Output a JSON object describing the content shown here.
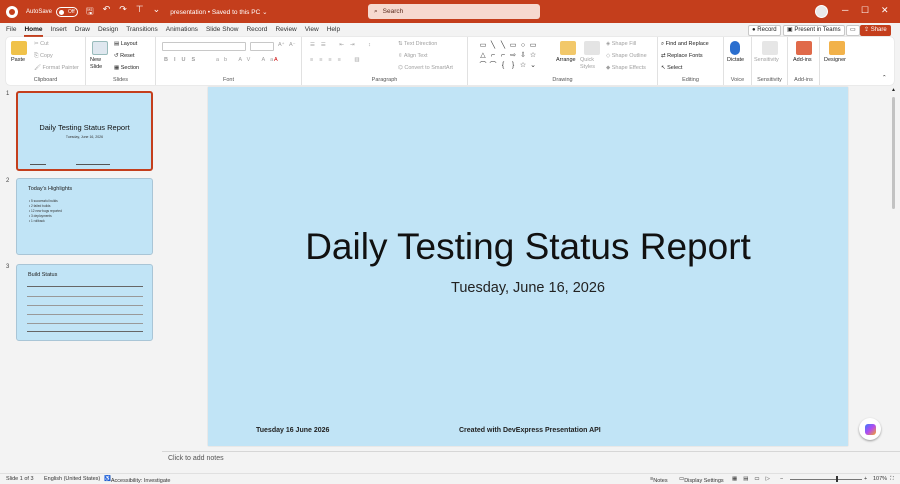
{
  "titlebar": {
    "autosave_label": "AutoSave",
    "autosave_state": "Off",
    "doc_title": "presentation • Saved to this PC ⌄",
    "search_placeholder": "Search",
    "accent": "#c43e1c"
  },
  "menu": {
    "tabs": [
      "File",
      "Home",
      "Insert",
      "Draw",
      "Design",
      "Transitions",
      "Animations",
      "Slide Show",
      "Record",
      "Review",
      "View",
      "Help"
    ],
    "active": "Home",
    "record_label": "Record",
    "teams_label": "Present in Teams",
    "share_label": "Share"
  },
  "ribbon": {
    "clipboard": {
      "paste": "Paste",
      "cut": "Cut",
      "copy": "Copy",
      "format_painter": "Format Painter",
      "label": "Clipboard"
    },
    "slides": {
      "new_slide": "New Slide",
      "layout": "Layout",
      "reset": "Reset",
      "section": "Section",
      "label": "Slides"
    },
    "font": {
      "label": "Font"
    },
    "paragraph": {
      "text_direction": "Text Direction",
      "align_text": "Align Text",
      "convert_smartart": "Convert to SmartArt",
      "label": "Paragraph"
    },
    "drawing": {
      "arrange": "Arrange",
      "quick_styles": "Quick Styles",
      "shape_fill": "Shape Fill",
      "shape_outline": "Shape Outline",
      "shape_effects": "Shape Effects",
      "label": "Drawing"
    },
    "editing": {
      "find_replace": "Find and Replace",
      "replace_fonts": "Replace Fonts",
      "select": "Select",
      "label": "Editing"
    },
    "voice": {
      "dictate": "Dictate",
      "label": "Voice"
    },
    "sensitivity": {
      "sensitivity": "Sensitivity",
      "label": "Sensitivity"
    },
    "addins": {
      "addins": "Add-ins",
      "label": "Add-ins"
    },
    "designer": {
      "designer": "Designer"
    }
  },
  "thumbnails": [
    {
      "number": "1",
      "title": "Daily Testing Status Report",
      "subtitle": "Tuesday, June 16, 2026"
    },
    {
      "number": "2",
      "title": "Today's Highlights",
      "bullets": [
        "5 successful builds",
        "2 failed builds",
        "12 new bugs reported",
        "3 deployments",
        "1 rollback"
      ]
    },
    {
      "number": "3",
      "title": "Build Status"
    }
  ],
  "slide": {
    "title": "Daily Testing Status Report",
    "subtitle": "Tuesday, June 16, 2026",
    "footer_date": "Tuesday 16 June 2026",
    "footer_credit": "Created with DevExpress Presentation API",
    "background": "#c1e4f6"
  },
  "notes_placeholder": "Click to add notes",
  "status": {
    "slide_count": "Slide 1 of 3",
    "language": "English (United States)",
    "accessibility": "Accessibility: Investigate",
    "notes": "Notes",
    "display_settings": "Display Settings",
    "zoom": "107%"
  }
}
